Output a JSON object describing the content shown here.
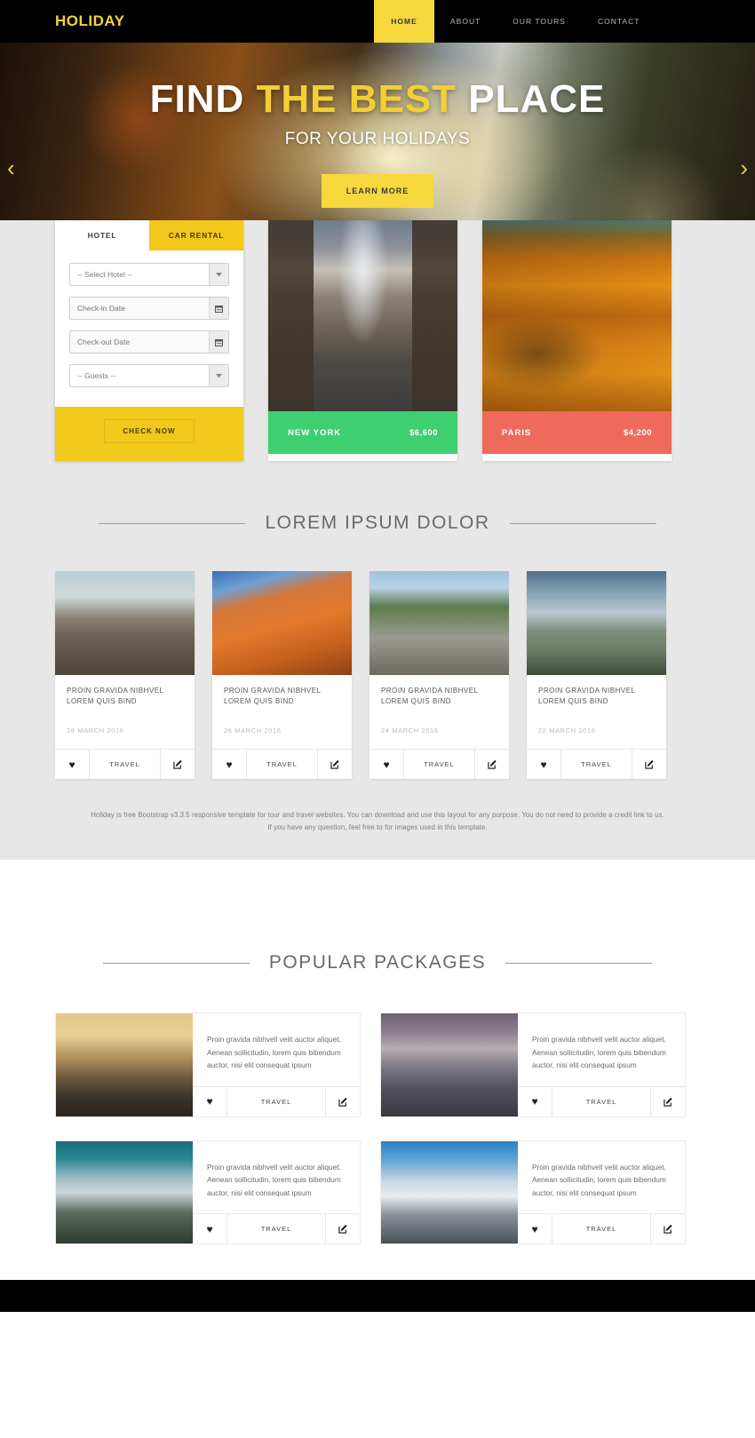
{
  "nav": {
    "brand": "HOLIDAY",
    "links": [
      {
        "label": "HOME",
        "active": true
      },
      {
        "label": "ABOUT",
        "active": false
      },
      {
        "label": "OUR TOURS",
        "active": false
      },
      {
        "label": "CONTACT",
        "active": false
      }
    ]
  },
  "hero": {
    "title_part1": "FIND ",
    "title_highlight": "THE BEST",
    "title_part2": " PLACE",
    "subtitle": "FOR YOUR HOLIDAYS",
    "button": "LEARN MORE",
    "prev_arrow": "‹",
    "next_arrow": "›"
  },
  "booking": {
    "tabs": [
      {
        "label": "HOTEL",
        "active": false
      },
      {
        "label": "CAR RENTAL",
        "active": true
      }
    ],
    "hotel_select": "-- Select Hotel --",
    "checkin_placeholder": "Check-in Date",
    "checkout_placeholder": "Check-out Date",
    "guests_select": "-- Guests --",
    "submit": "CHECK NOW",
    "calendar_icon": "Ὄ5",
    "chevron": "⌄"
  },
  "destinations": [
    {
      "name": "NEW YORK",
      "price": "$6,600",
      "bar_color": "#3ecf71"
    },
    {
      "name": "PARIS",
      "price": "$4,200",
      "bar_color": "#ef6a5b"
    }
  ],
  "blog_section": {
    "title": "LOREM IPSUM DOLOR",
    "cards": [
      {
        "title": "PROIN GRAVIDA NIBHVEL LOREM QUIS BIND",
        "date": "28 MARCH 2016",
        "category": "TRAVEL"
      },
      {
        "title": "PROIN GRAVIDA NIBHVEL LOREM QUIS BIND",
        "date": "26 MARCH 2016",
        "category": "TRAVEL"
      },
      {
        "title": "PROIN GRAVIDA NIBHVEL LOREM QUIS BIND",
        "date": "24 MARCH 2016",
        "category": "TRAVEL"
      },
      {
        "title": "PROIN GRAVIDA NIBHVEL LOREM QUIS BIND",
        "date": "22 MARCH 2016",
        "category": "TRAVEL"
      }
    ],
    "blurb": "Holiday is free Bootstrap v3.3.5 responsive template for tour and travel websites. You can download and use this layout for any purpose. You do not need to provide a credit link to us. If you have any question, feel free to for images used in this template."
  },
  "packages_section": {
    "title": "POPULAR PACKAGES",
    "cards": [
      {
        "text": "Proin gravida nibhvell velit auctor aliquet. Aenean sollicitudin, lorem quis bibendum auctor, nisi elit consequat ipsum",
        "category": "TRAVEL"
      },
      {
        "text": "Proin gravida nibhvell velit auctor aliquet. Aenean sollicitudin, lorem quis bibendum auctor, nisi elit consequat ipsum",
        "category": "TRAVEL"
      },
      {
        "text": "Proin gravida nibhvell velit auctor aliquet. Aenean sollicitudin, lorem quis bibendum auctor, nisi elit consequat ipsum",
        "category": "TRAVEL"
      },
      {
        "text": "Proin gravida nibhvell velit auctor aliquet. Aenean sollicitudin, lorem quis bibendum auctor, nisi elit consequat ipsum",
        "category": "TRAVEL"
      }
    ]
  },
  "icons": {
    "heart": "♥",
    "edit": "✎"
  },
  "colors": {
    "brand_yellow": "#f7d83d",
    "booking_yellow": "#f2c81c",
    "green": "#3ecf71",
    "red": "#ef6a5b",
    "black": "#000000",
    "grey_bg": "#e7e7e7"
  }
}
